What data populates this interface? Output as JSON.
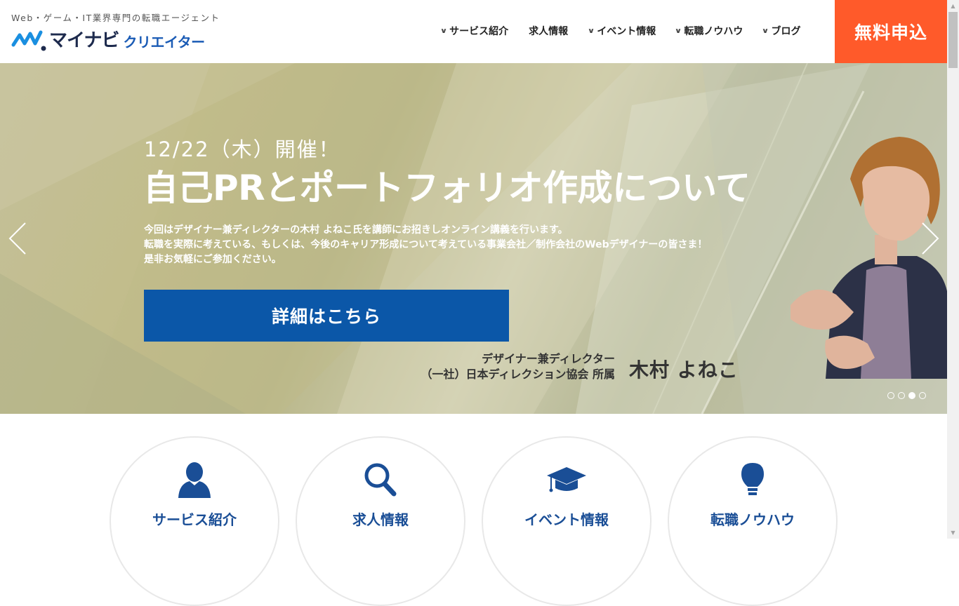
{
  "header": {
    "tagline": "Web・ゲーム・IT業界専門の転職エージェント",
    "logo_main": "マイナビ",
    "logo_sub": "クリエイター",
    "nav": [
      {
        "label": "サービス紹介",
        "dropdown": true
      },
      {
        "label": "求人情報",
        "dropdown": false
      },
      {
        "label": "イベント情報",
        "dropdown": true
      },
      {
        "label": "転職ノウハウ",
        "dropdown": true
      },
      {
        "label": "ブログ",
        "dropdown": true
      }
    ],
    "apply_label": "無料申込",
    "apply_color": "#ff5a2a"
  },
  "hero": {
    "date": "12/22（木）開催！",
    "title": "自己PRとポートフォリオ作成について",
    "desc": [
      "今回はデザイナー兼ディレクターの木村 よねこ氏を講師にお招きしオンライン講義を行います。",
      "転職を実際に考えている、もしくは、今後のキャリア形成について考えている事業会社／制作会社のWebデザイナーの皆さま！",
      "是非お気軽にご参加ください。"
    ],
    "cta_label": "詳細はこちら",
    "cta_color": "#0b57a8",
    "speaker_role_1": "デザイナー兼ディレクター",
    "speaker_role_2": "（一社）日本ディレクション協会 所属",
    "speaker_name": "木村 よねこ",
    "slide_count": 4,
    "active_slide": 3
  },
  "features": [
    {
      "label": "サービス紹介",
      "icon": "person-icon"
    },
    {
      "label": "求人情報",
      "icon": "search-icon"
    },
    {
      "label": "イベント情報",
      "icon": "graduation-cap-icon"
    },
    {
      "label": "転職ノウハウ",
      "icon": "lightbulb-icon"
    }
  ]
}
